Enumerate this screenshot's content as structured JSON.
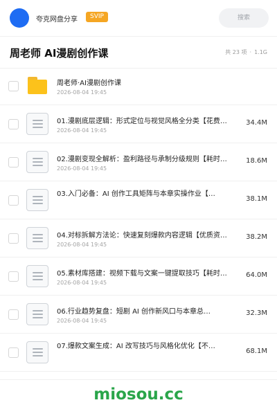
{
  "header": {
    "app_name": "夸克网盘分享",
    "badge": "SVIP",
    "search_placeholder": "搜索",
    "accent_color": "#1e6cf3"
  },
  "folder": {
    "title": "周老师 AI漫剧创作课",
    "count_text": "共 23 项",
    "size_text": "1.1G"
  },
  "items": [
    {
      "icon": "folder-icon",
      "name": "周老师·AI漫剧创作课",
      "date": "2026-08-04 19:45",
      "size": ""
    },
    {
      "icon": "document-icon",
      "name": "01.漫剧底层逻辑：形式定位与视觉风格全分类【花费…",
      "date": "2026-08-04 19:45",
      "size": "34.4M"
    },
    {
      "icon": "document-icon",
      "name": "02.漫剧变现全解析：盈利路径与承制分级规则【耗时…",
      "date": "2026-08-04 19:45",
      "size": "18.6M"
    },
    {
      "icon": "document-icon",
      "name": "03.入门必备：AI 创作工具矩阵与本章实操作业【…",
      "date": "",
      "size": "38.1M"
    },
    {
      "icon": "document-icon",
      "name": "04.对标拆解方法论：快速复刻爆款内容逻辑【优质资…",
      "date": "2026-08-04 19:45",
      "size": "38.2M"
    },
    {
      "icon": "document-icon",
      "name": "05.素材库搭建：视频下载与文案一键提取技巧【耗时…",
      "date": "2026-08-04 19:45",
      "size": "64.0M"
    },
    {
      "icon": "document-icon",
      "name": "06.行业趋势复盘：短剧 AI 创作新风口与本章总…",
      "date": "2026-08-04 19:45",
      "size": "32.3M"
    },
    {
      "icon": "document-icon",
      "name": "07.爆款文案生成：AI 改写技巧与风格化优化【不…",
      "date": "",
      "size": "68.1M"
    }
  ],
  "footer": {
    "watermark": "miosou.cc",
    "watermark_color": "#2aa54a"
  }
}
